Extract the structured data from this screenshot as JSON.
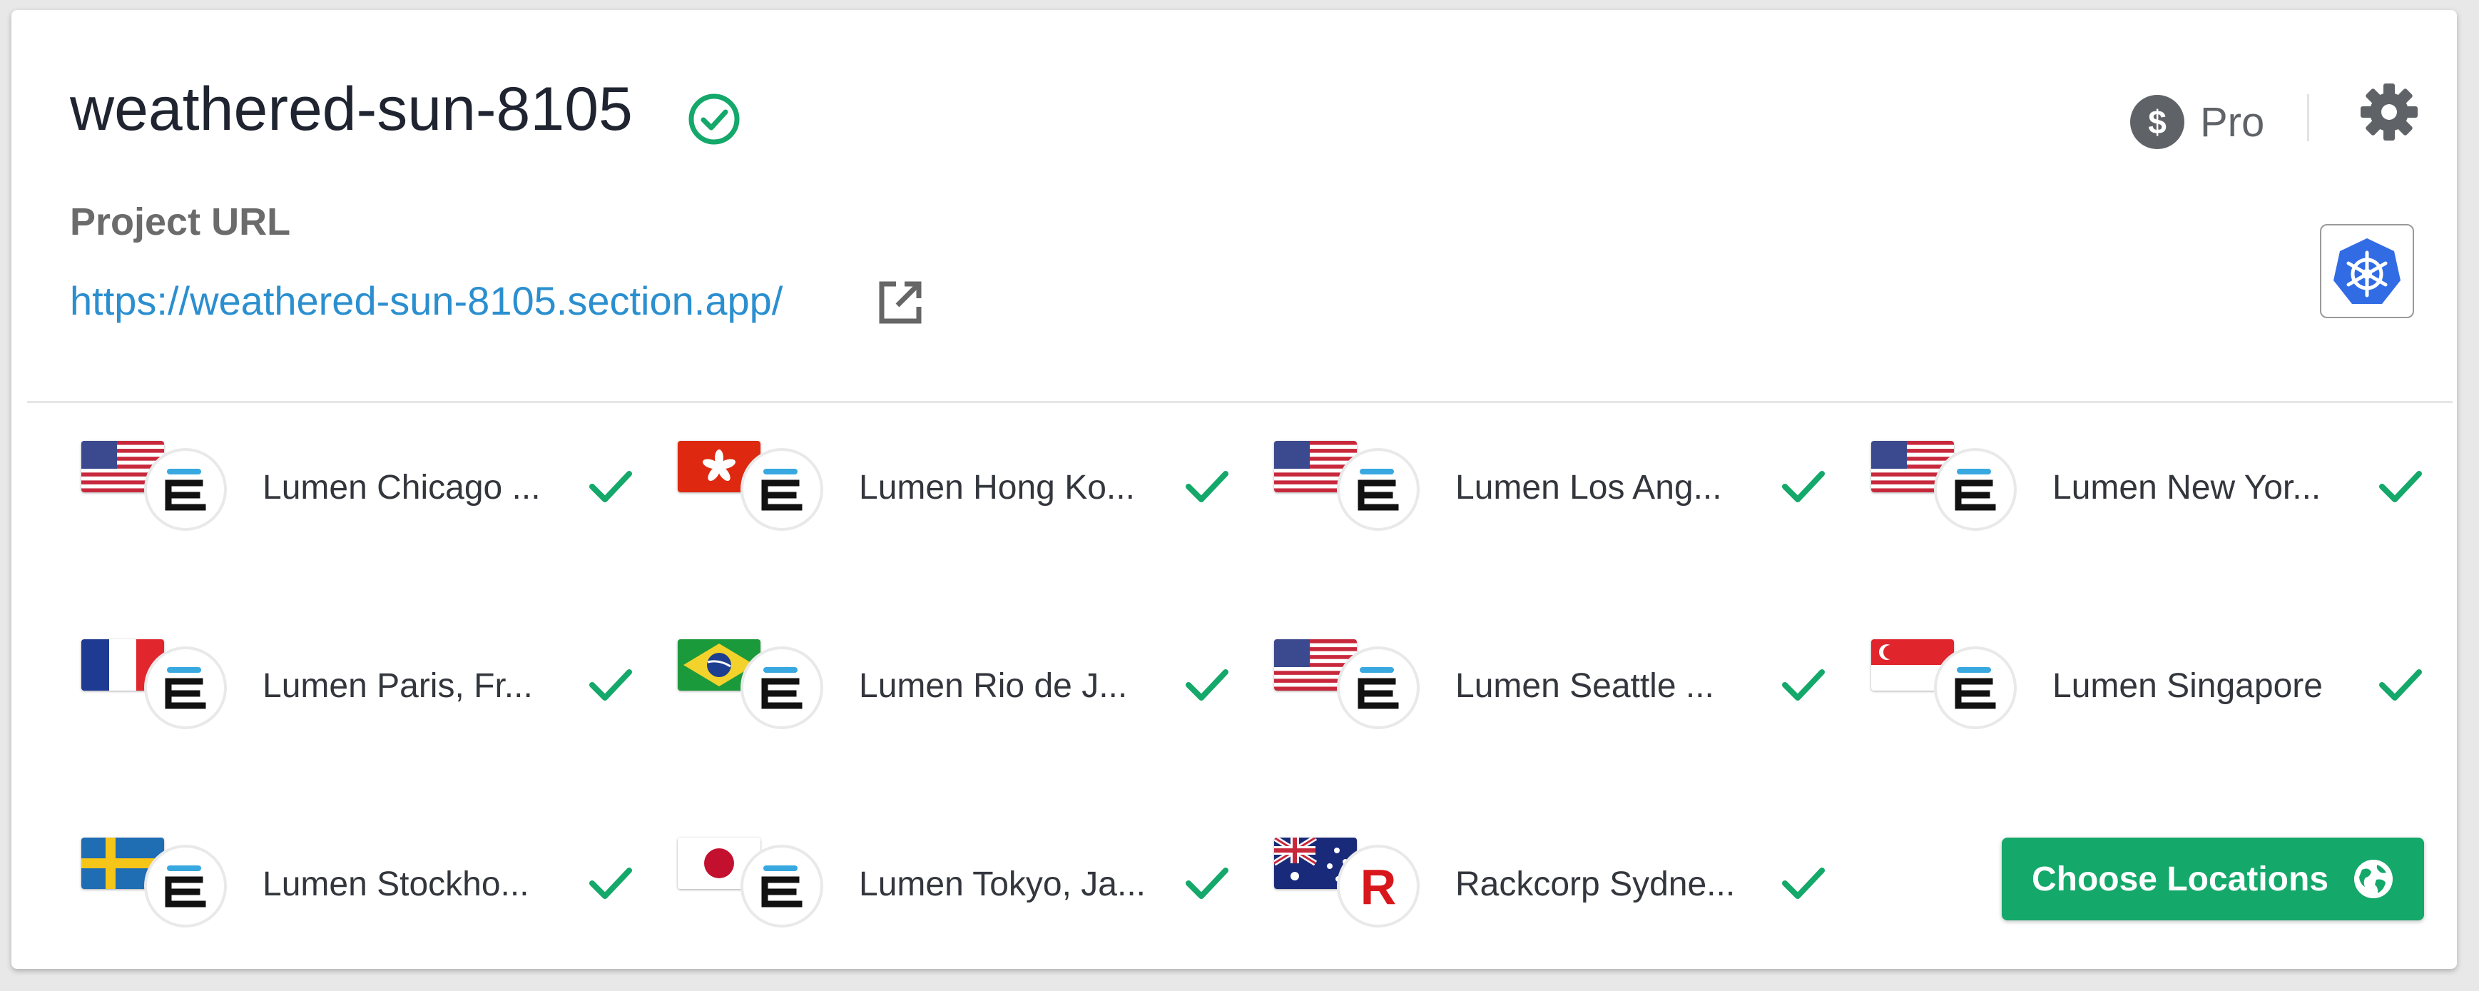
{
  "project": {
    "name": "weathered-sun-8105",
    "status": "healthy",
    "url_label": "Project URL",
    "url": "https://weathered-sun-8105.section.app/",
    "plan": "Pro"
  },
  "colors": {
    "accent_green": "#14a86a",
    "link_blue": "#2b8fcf"
  },
  "icons": [
    "check-circle-icon",
    "external-link-icon",
    "dollar-coin-icon",
    "gear-icon",
    "kubernetes-icon",
    "checkmark-icon",
    "globe-icon"
  ],
  "locations": [
    {
      "name": "Lumen Chicago ...",
      "flag": "us",
      "provider": "lumen"
    },
    {
      "name": "Lumen Hong Ko...",
      "flag": "hk",
      "provider": "lumen"
    },
    {
      "name": "Lumen Los Ang...",
      "flag": "us",
      "provider": "lumen"
    },
    {
      "name": "Lumen New Yor...",
      "flag": "us",
      "provider": "lumen"
    },
    {
      "name": "Lumen Paris, Fr...",
      "flag": "fr",
      "provider": "lumen"
    },
    {
      "name": "Lumen Rio de J...",
      "flag": "br",
      "provider": "lumen"
    },
    {
      "name": "Lumen Seattle ...",
      "flag": "us",
      "provider": "lumen"
    },
    {
      "name": "Lumen Singapore",
      "flag": "sg",
      "provider": "lumen"
    },
    {
      "name": "Lumen Stockho...",
      "flag": "se",
      "provider": "lumen"
    },
    {
      "name": "Lumen Tokyo, Ja...",
      "flag": "jp",
      "provider": "lumen"
    },
    {
      "name": "Rackcorp Sydne...",
      "flag": "au",
      "provider": "rackcorp"
    }
  ],
  "actions": {
    "choose_locations": "Choose Locations"
  }
}
